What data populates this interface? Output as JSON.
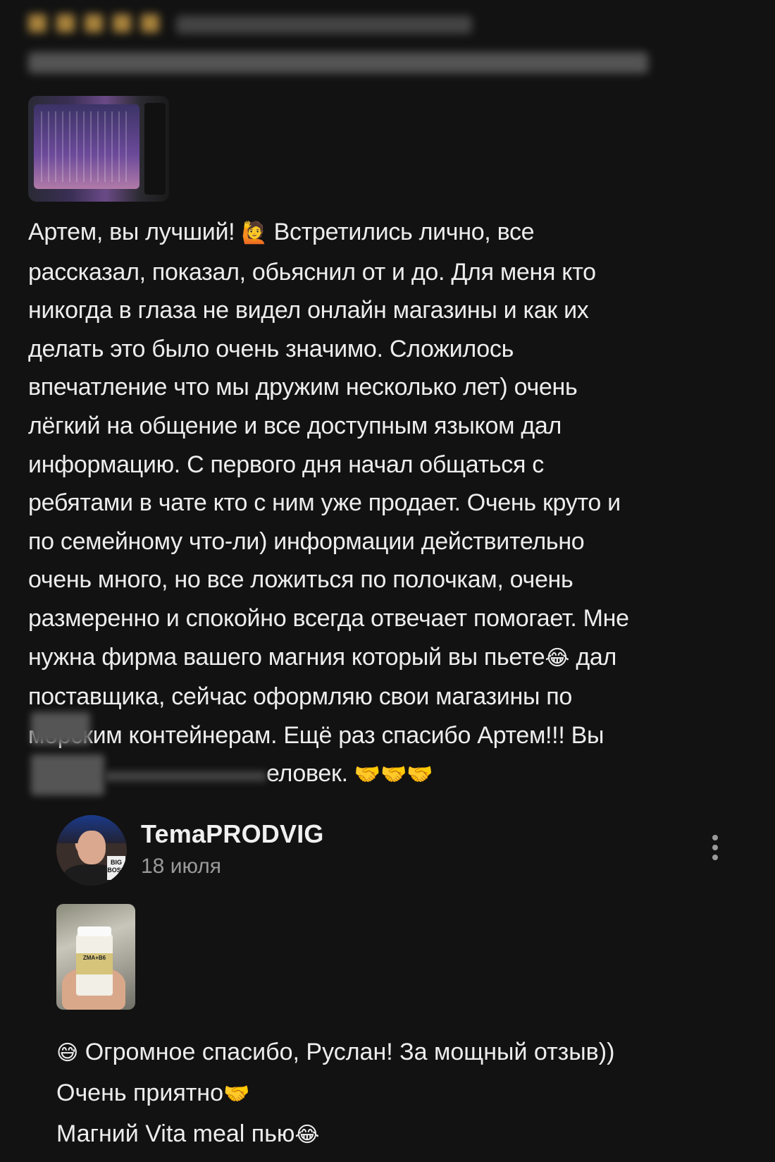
{
  "review": {
    "lines": [
      "Артем, вы лучший! ",
      " Встретились лично, все",
      "рассказал, показал, обьяснил от и до. Для меня кто",
      "никогда в глаза не видел онлайн магазины и как их",
      "делать это было очень значимо. Сложилось",
      "впечатление что мы дружим несколько лет) очень",
      "лёгкий на общение и все доступным языком дал",
      "информацию. С первого дня начал общаться с",
      "ребятами в чате кто с ним уже продает. Очень круто и",
      "по семейному что-ли) информации действительно",
      "очень много, но все ложиться по полочкам, очень",
      "размеренно и спокойно всегда отвечает помогает. Мне",
      "нужна фирма вашего магния который вы пьете",
      "  дал",
      "поставщика, сейчас оформляю свои магазины по",
      "морским контейнерам. Ещё раз спасибо Артем!!! Вы",
      "еловек."
    ],
    "emoji_salute": "🙋",
    "emoji_laugh": "😂",
    "emoji_handshakes": "🤝🤝🤝"
  },
  "reply": {
    "username": "TemaPRODVIG",
    "date": "18 июля",
    "photo_label": "ZMA+B6",
    "avatar_sign": "BIG BOSS",
    "line1": "Огромное спасибо, Руслан! За мощный отзыв))",
    "line2": "Очень приятно",
    "line3": "Магний Vita meal пью",
    "emoji_sweat": "😅",
    "emoji_handshake": "🤝",
    "emoji_laugh": "😂"
  }
}
